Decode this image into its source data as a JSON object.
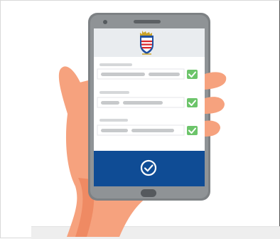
{
  "illustration": {
    "emblem": "hessen-coat-of-arms",
    "icons": {
      "field_1_status": "check-icon",
      "field_2_status": "check-icon",
      "field_3_status": "check-icon",
      "confirm": "check-circle-icon"
    },
    "colors": {
      "phone_body": "#7d8184",
      "phone_bezel": "#8f9396",
      "screen_top": "#e9ecef",
      "confirm_panel": "#0f4c95",
      "check_badge": "#6cc46a",
      "skin": "#f6a27e",
      "skin_shadow": "#ef8a63",
      "placeholder_line": "#c7c9cb"
    }
  }
}
